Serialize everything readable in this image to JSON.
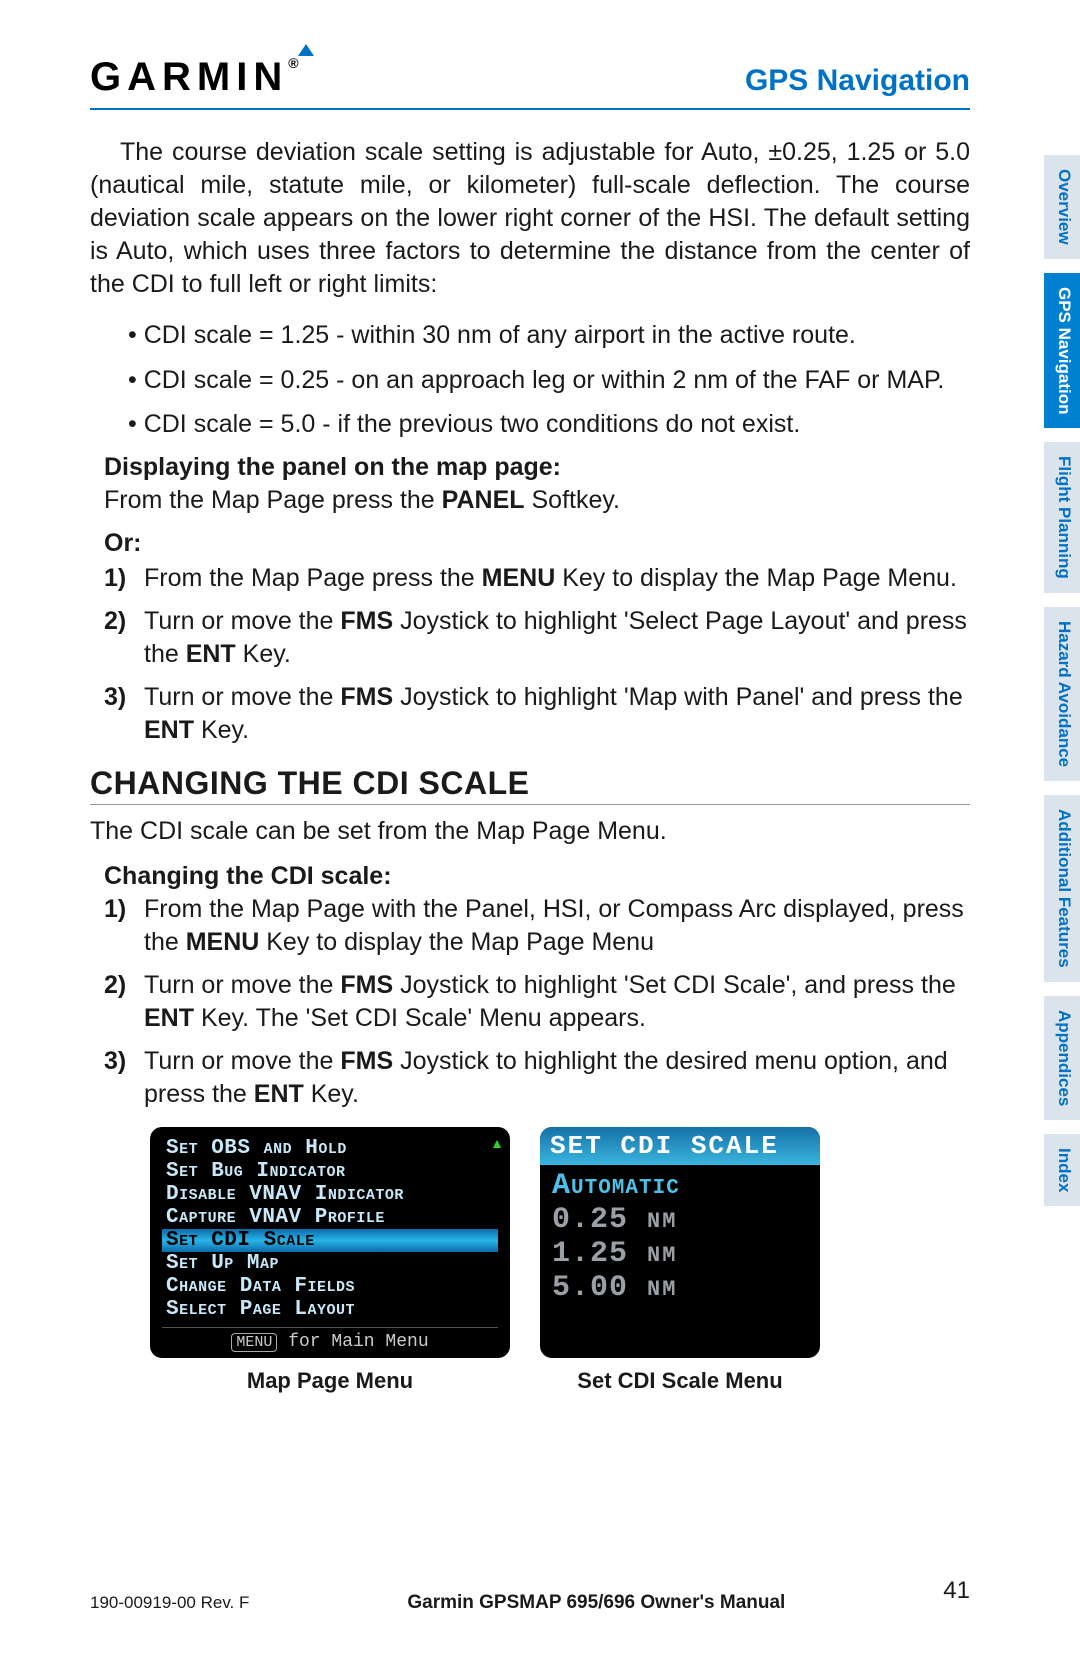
{
  "header": {
    "logo_text": "GARMIN",
    "section_title": "GPS Navigation"
  },
  "intro": "The course deviation scale setting is adjustable for Auto, ±0.25, 1.25 or 5.0 (nautical mile, statute mile, or kilometer) full-scale deflection.  The course deviation scale appears on the lower right corner of the HSI.  The default setting is Auto, which uses three factors to determine the distance from the center of the CDI to full left or right limits:",
  "bullets": [
    "CDI scale = 1.25 - within 30 nm of any airport in the active route.",
    "CDI scale = 0.25 - on an approach leg or within 2 nm of the FAF or MAP.",
    "CDI scale = 5.0 - if the previous two conditions do not exist."
  ],
  "panel_head": "Displaying the panel on the map page:",
  "panel_line_pre": "From the Map Page press the ",
  "panel_line_bold": "PANEL",
  "panel_line_post": " Softkey.",
  "or_label": "Or:",
  "steps_a": [
    {
      "n": "1)",
      "pre": "From the Map Page press the ",
      "b": "MENU",
      "post": " Key to display the Map Page Menu."
    },
    {
      "n": "2)",
      "pre": "Turn or move the ",
      "b": "FMS",
      "post": " Joystick to highlight 'Select Page Layout' and press the ",
      "b2": "ENT",
      "post2": " Key."
    },
    {
      "n": "3)",
      "pre": "Turn or move the ",
      "b": "FMS",
      "post": " Joystick to highlight 'Map with Panel' and press the ",
      "b2": "ENT",
      "post2": " Key."
    }
  ],
  "h2": "CHANGING THE CDI SCALE",
  "h2_sub": "The CDI scale can be set from the Map Page Menu.",
  "change_head": "Changing the CDI scale:",
  "steps_b": [
    {
      "n": "1)",
      "pre": "From the Map Page with the Panel, HSI, or Compass Arc displayed, press the ",
      "b": "MENU",
      "post": " Key to display the Map Page Menu"
    },
    {
      "n": "2)",
      "pre": "Turn or move the ",
      "b": "FMS",
      "post": " Joystick to highlight 'Set CDI Scale', and press the ",
      "b2": "ENT",
      "post2": " Key.  The 'Set CDI Scale' Menu appears."
    },
    {
      "n": "3)",
      "pre": "Turn or move the ",
      "b": "FMS",
      "post": " Joystick to highlight the desired menu option, and press the ",
      "b2": "ENT",
      "post2": " Key."
    }
  ],
  "map_menu": {
    "items": [
      "Set OBS and Hold",
      "Set Bug Indicator",
      "Disable VNAV Indicator",
      "Capture VNAV Profile",
      "Set CDI Scale",
      "Set Up Map",
      "Change Data Fields",
      "Select Page Layout"
    ],
    "selected_index": 4,
    "foot_btn": "menu",
    "foot_text": " for Main Menu",
    "caption": "Map Page Menu"
  },
  "cdi_menu": {
    "title": "SET CDI SCALE",
    "items": [
      "Automatic",
      "0.25 nm",
      "1.25 nm",
      "5.00 nm"
    ],
    "caption": "Set CDI Scale Menu"
  },
  "footer": {
    "left": "190-00919-00  Rev. F",
    "mid": "Garmin GPSMAP 695/696 Owner's Manual",
    "page": "41"
  },
  "tabs": [
    "Overview",
    "GPS Navigation",
    "Flight Planning",
    "Hazard Avoidance",
    "Additional Features",
    "Appendices",
    "Index"
  ],
  "active_tab_index": 1
}
